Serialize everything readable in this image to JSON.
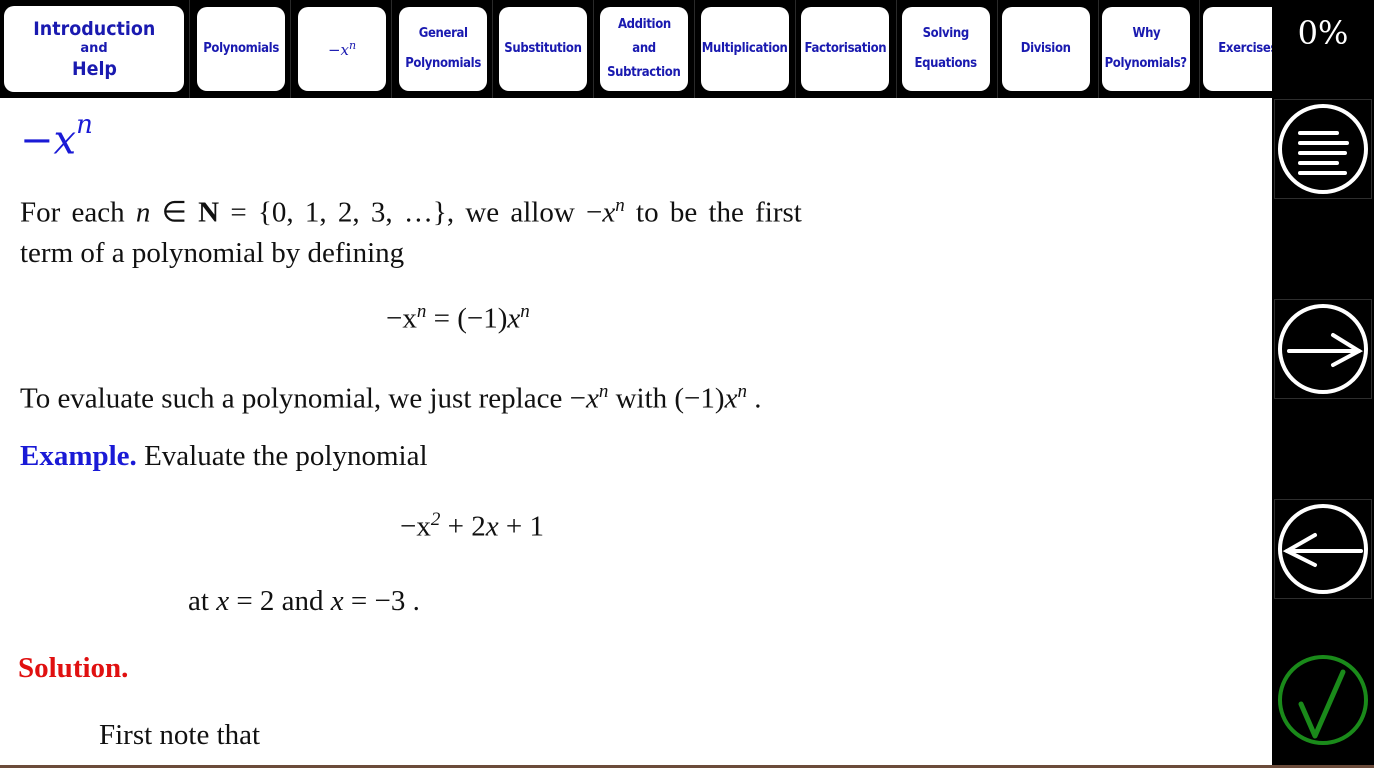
{
  "nav": {
    "intro": {
      "line1": "Introduction",
      "line2": "and",
      "line3": "Help"
    },
    "items": [
      {
        "id": "polynomials",
        "lines": [
          "Polynomials"
        ]
      },
      {
        "id": "minus-x-n",
        "math": "−x",
        "sup": "n"
      },
      {
        "id": "general-polynomials",
        "lines": [
          "General",
          "Polynomials"
        ]
      },
      {
        "id": "substitution",
        "lines": [
          "Substitution"
        ]
      },
      {
        "id": "addition-subtraction",
        "lines": [
          "Addition",
          "and",
          "Subtraction"
        ]
      },
      {
        "id": "multiplication",
        "lines": [
          "Multiplication"
        ]
      },
      {
        "id": "factorisation",
        "lines": [
          "Factorisation"
        ]
      },
      {
        "id": "solving-equations",
        "lines": [
          "Solving",
          "Equations"
        ]
      },
      {
        "id": "division",
        "lines": [
          "Division"
        ]
      },
      {
        "id": "why-polynomials",
        "lines": [
          "Why",
          "Polynomials?"
        ]
      },
      {
        "id": "exercises",
        "lines": [
          "Exercises"
        ]
      }
    ]
  },
  "rail": {
    "progress": "0%",
    "buttons": [
      {
        "id": "menu",
        "icon": "menu-icon"
      },
      {
        "id": "next",
        "icon": "arrow-right-icon"
      },
      {
        "id": "back",
        "icon": "arrow-left-icon"
      },
      {
        "id": "check",
        "icon": "checkmark-icon"
      }
    ]
  },
  "colors": {
    "nav_text": "#1a1ab0",
    "title": "#1a1ad6",
    "example_label": "#1a1ad6",
    "solution_label": "#e01010",
    "check": "#1a8a1a",
    "rail_bg": "#000000"
  },
  "page": {
    "title_base": "−x",
    "title_sup": "n",
    "para1": {
      "t1": "For each ",
      "n": "n",
      "t2": " ∈ ",
      "N": "N",
      "t3": " = {0, 1, 2, 3, …}, we allow −",
      "x": "x",
      "sup": "n",
      "t4": " to be the first",
      "line2": "term of a polynomial by defining"
    },
    "display1": {
      "lhs": "−x",
      "lhs_sup": "n",
      "eq": " = (−1)",
      "rhs": "x",
      "rhs_sup": "n"
    },
    "para2": {
      "t1": "To evaluate such a polynomial, we just replace −",
      "x": "x",
      "sup": "n",
      "t2": " with (−1)",
      "x2": "x",
      "sup2": "n",
      "t3": " ."
    },
    "example": {
      "label": "Example.",
      "text": " Evaluate the polynomial"
    },
    "display2": {
      "a": "−x",
      "sup": "2",
      "b": " + 2",
      "x": "x",
      "c": " + 1"
    },
    "at_line": {
      "t1": "at ",
      "x1": "x",
      "t2": " = 2 and ",
      "x2": "x",
      "t3": " = −3 ."
    },
    "solution": {
      "label": "Solution."
    },
    "first_note": "First note that"
  }
}
